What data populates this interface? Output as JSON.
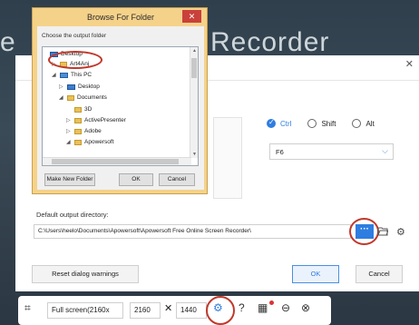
{
  "background": {
    "title_right": "Recorder",
    "title_left": "e"
  },
  "settings": {
    "modifiers": [
      {
        "label": "Ctrl",
        "checked": true
      },
      {
        "label": "Shift",
        "checked": false
      },
      {
        "label": "Alt",
        "checked": false
      }
    ],
    "hotkey": "F6",
    "output_label": "Default output directory:",
    "output_path": "C:\\Users\\heelo\\Documents\\Apowersoft\\Apowersoft Free Online Screen Recorder\\",
    "browse_label": "···",
    "reset_label": "Reset dialog warnings",
    "ok_label": "OK",
    "cancel_label": "Cancel",
    "close_icon": "close-icon",
    "accent_color": "#2e7de1"
  },
  "browse_dialog": {
    "title": "Browse For Folder",
    "prompt": "Choose the output folder",
    "close_glyph": "✕",
    "tree": [
      {
        "label": "Desktop",
        "icon": "desktop-icon",
        "toggle": "",
        "selected": true
      },
      {
        "label": "Art4Anj",
        "icon": "folder-icon",
        "toggle": "▷"
      },
      {
        "label": "This PC",
        "icon": "pc-icon",
        "toggle": "◢"
      },
      {
        "label": "Desktop",
        "icon": "desktop-icon",
        "toggle": "▷"
      },
      {
        "label": "Documents",
        "icon": "folder-icon",
        "toggle": "◢"
      },
      {
        "label": "3D",
        "icon": "folder-icon",
        "toggle": ""
      },
      {
        "label": "ActivePresenter",
        "icon": "folder-icon",
        "toggle": "▷"
      },
      {
        "label": "Adobe",
        "icon": "folder-icon",
        "toggle": "▷"
      },
      {
        "label": "Apowersoft",
        "icon": "folder-icon",
        "toggle": "◢"
      }
    ],
    "make_folder_label": "Make New Folder",
    "ok_label": "OK",
    "cancel_label": "Cancel"
  },
  "toolbar": {
    "mode": "Full screen(2160x",
    "width": "2160",
    "times": "✕",
    "height": "1440",
    "icons": [
      "crosshair-icon",
      "settings-gear-icon",
      "help-icon",
      "apps-icon",
      "minimize-icon",
      "close-icon"
    ]
  }
}
